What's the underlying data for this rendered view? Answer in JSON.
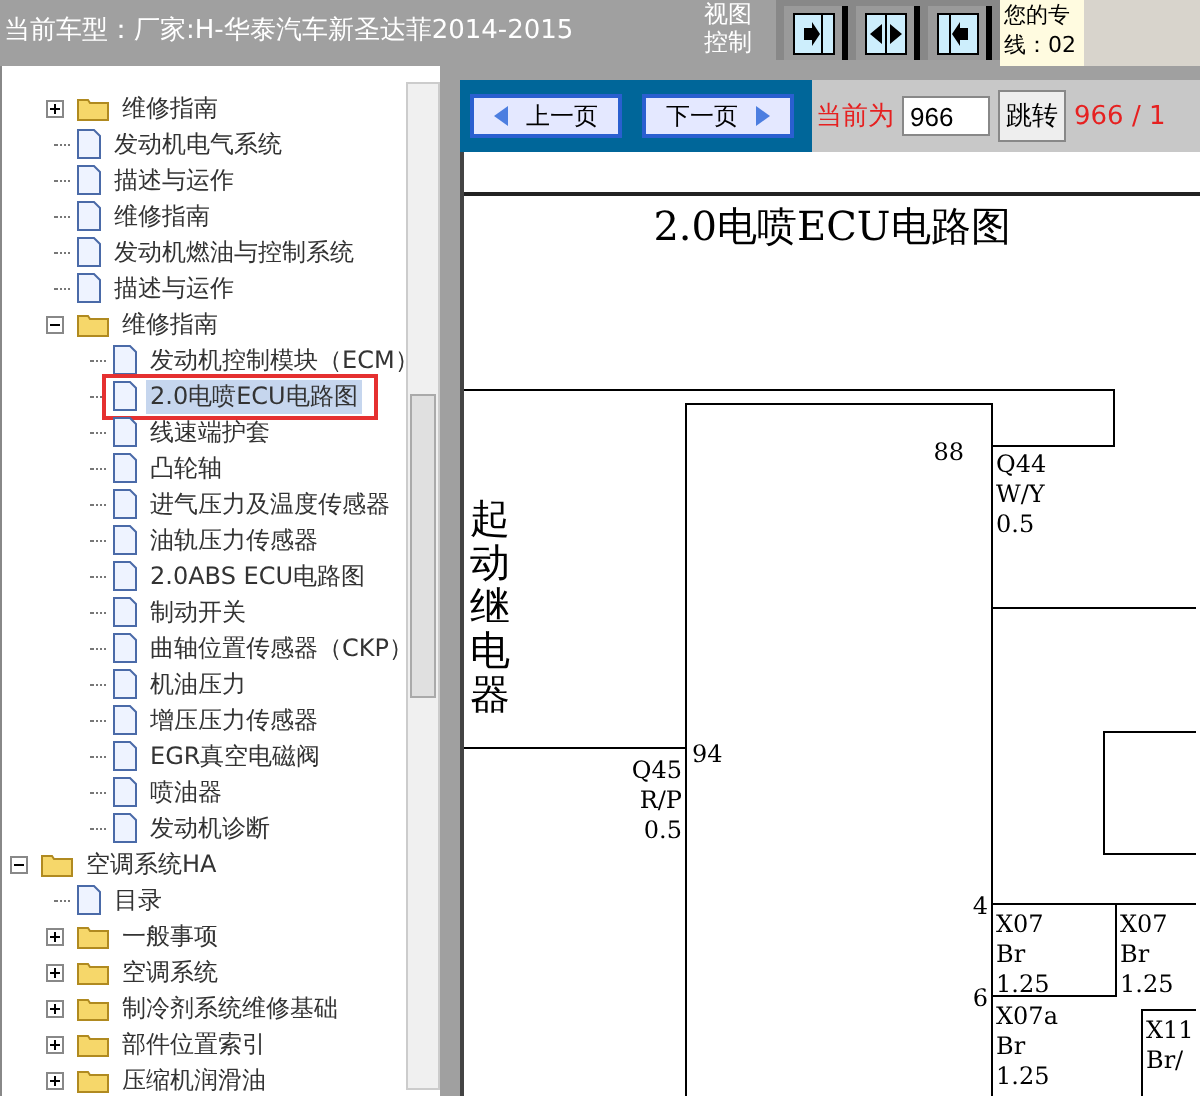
{
  "header": {
    "title": "当前车型：厂家:H-华泰汽车新圣达菲2014-2015",
    "view_control": "视图控制",
    "notice_lines": [
      "您的专",
      "线：02"
    ]
  },
  "tree": {
    "continued_items": [
      {
        "label": "维修指南",
        "kind": "folder",
        "expanded": false,
        "selected": false
      },
      {
        "label": "发动机电气系统",
        "kind": "page",
        "selected": false
      },
      {
        "label": "描述与运作",
        "kind": "page",
        "selected": false
      },
      {
        "label": "维修指南",
        "kind": "page",
        "selected": false
      },
      {
        "label": "发动机燃油与控制系统",
        "kind": "page",
        "selected": false
      },
      {
        "label": "描述与运作",
        "kind": "page",
        "selected": false
      },
      {
        "label": "维修指南",
        "kind": "folder",
        "expanded": true,
        "selected": false,
        "children": [
          {
            "label": "发动机控制模块（ECM）",
            "kind": "page",
            "selected": false
          },
          {
            "label": "2.0电喷ECU电路图",
            "kind": "page",
            "selected": true
          },
          {
            "label": "线速端护套",
            "kind": "page",
            "selected": false
          },
          {
            "label": "凸轮轴",
            "kind": "page",
            "selected": false
          },
          {
            "label": "进气压力及温度传感器",
            "kind": "page",
            "selected": false
          },
          {
            "label": "油轨压力传感器",
            "kind": "page",
            "selected": false
          },
          {
            "label": "2.0ABS ECU电路图",
            "kind": "page",
            "selected": false
          },
          {
            "label": "制动开关",
            "kind": "page",
            "selected": false
          },
          {
            "label": "曲轴位置传感器（CKP）",
            "kind": "page",
            "selected": false
          },
          {
            "label": "机油压力",
            "kind": "page",
            "selected": false
          },
          {
            "label": "增压压力传感器",
            "kind": "page",
            "selected": false
          },
          {
            "label": "EGR真空电磁阀",
            "kind": "page",
            "selected": false
          },
          {
            "label": "喷油器",
            "kind": "page",
            "selected": false
          },
          {
            "label": "发动机诊断",
            "kind": "page",
            "selected": false
          }
        ]
      }
    ],
    "items": [
      {
        "label": "空调系统HA",
        "kind": "folder",
        "expanded": true,
        "selected": false,
        "children": [
          {
            "label": "目录",
            "kind": "page",
            "selected": false
          },
          {
            "label": "一般事项",
            "kind": "folder",
            "expanded": false,
            "selected": false
          },
          {
            "label": "空调系统",
            "kind": "folder",
            "expanded": false,
            "selected": false
          },
          {
            "label": "制冷剂系统维修基础",
            "kind": "folder",
            "expanded": false,
            "selected": false
          },
          {
            "label": "部件位置索引",
            "kind": "folder",
            "expanded": false,
            "selected": false
          },
          {
            "label": "压缩机润滑油",
            "kind": "folder",
            "expanded": false,
            "selected": false
          }
        ]
      }
    ]
  },
  "pager": {
    "prev": "上一页",
    "next": "下一页",
    "current_label": "当前为",
    "page_value": "966",
    "go": "跳转",
    "page_count": "966 / 1"
  },
  "diagram": {
    "title": "2.0电喷ECU电路图",
    "component": "起动继电器",
    "texts": [
      "88",
      "Q44",
      "W/Y",
      "0.5",
      "94",
      "Q45",
      "R/P",
      "0.5",
      "4",
      "X07",
      "Br",
      "1.25",
      "X07",
      "Br",
      "1.25",
      "6",
      "X07a",
      "Br",
      "1.25",
      "X11",
      "Br/"
    ]
  }
}
